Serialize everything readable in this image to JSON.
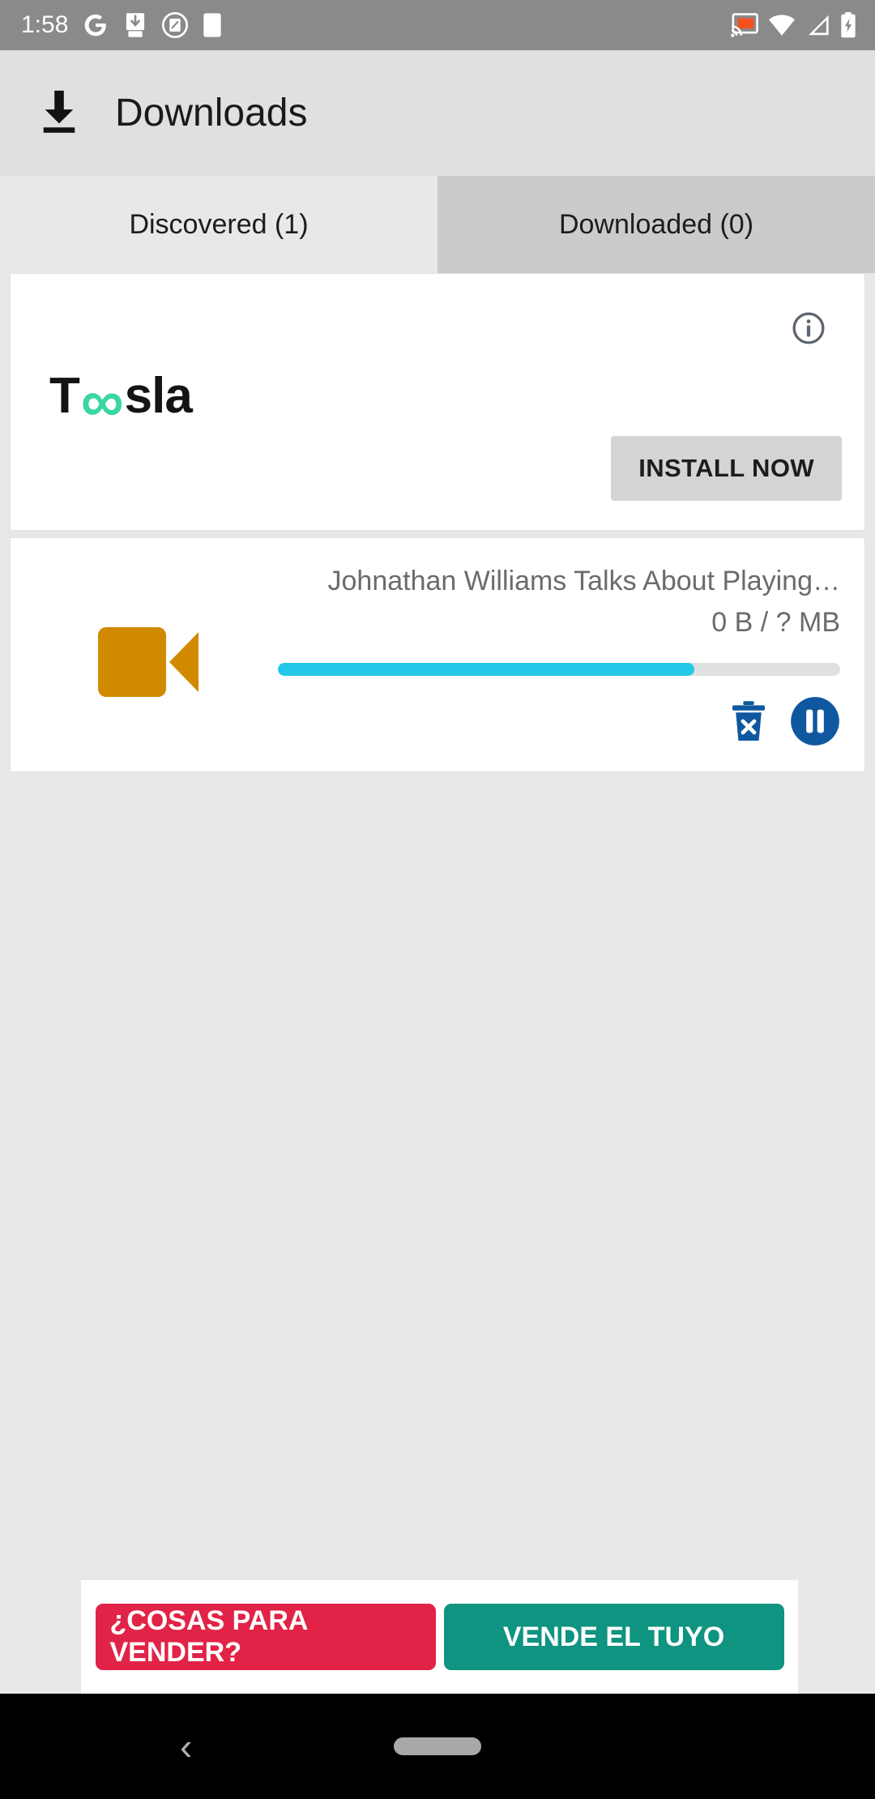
{
  "statusbar": {
    "time": "1:58",
    "left_icons": [
      "google-icon",
      "download-app-icon",
      "screenshot-icon",
      "blank-app-icon"
    ],
    "right_icons": [
      "cast-icon",
      "wifi-icon",
      "signal-icon",
      "battery-charging-icon"
    ],
    "background": "#8a8a8a"
  },
  "appbar": {
    "icon": "download-icon",
    "title": "Downloads",
    "background": "#e0e0e0"
  },
  "tabs": [
    {
      "label": "Discovered (1)",
      "active": true
    },
    {
      "label": "Downloaded (0)",
      "active": false
    }
  ],
  "ad_card": {
    "info_icon": "info-circle-icon",
    "brand_prefix": "T",
    "brand_symbol": "∞",
    "brand_suffix": "sla",
    "brand_color": "#3ad6a3",
    "install_label": "INSTALL NOW",
    "install_bg": "#d4d4d4"
  },
  "download_item": {
    "type_icon": "video-camera-icon",
    "type_icon_color": "#d18a00",
    "title": "Johnathan Williams Talks About Playing…",
    "size": "0 B / ? MB",
    "progress_percent": 74,
    "progress_color": "#22c8e8",
    "track_color": "#e0e0e0",
    "actions": [
      {
        "name": "delete-button",
        "icon": "trash-x-icon",
        "color": "#0f58a0"
      },
      {
        "name": "pause-button",
        "icon": "pause-circle-icon",
        "color": "#0f58a0"
      }
    ]
  },
  "banner_ad": {
    "pills": [
      {
        "text": "¿COSAS PARA VENDER?",
        "color": "#e12347"
      },
      {
        "text": "VENDE EL TUYO",
        "color": "#0e9480"
      }
    ]
  },
  "navbar": {
    "back_glyph": "‹",
    "home_indicator": "home-pill"
  }
}
